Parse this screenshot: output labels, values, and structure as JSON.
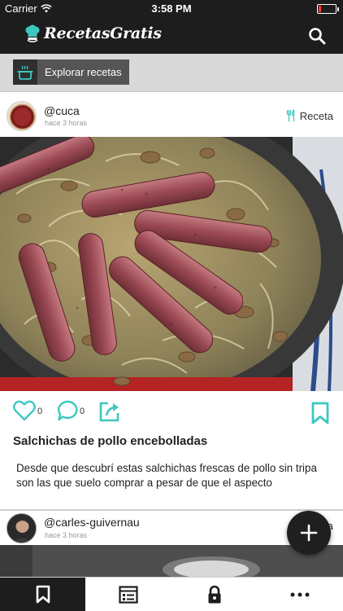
{
  "status_bar": {
    "carrier": "Carrier",
    "time": "3:58 PM",
    "battery_level": 0.15
  },
  "header": {
    "app_name": "RecetasGratis",
    "icons": [
      "chef-hat-icon",
      "search-icon"
    ]
  },
  "explore": {
    "label": "Explorar recetas",
    "icon": "pot-icon"
  },
  "posts": [
    {
      "username": "@cuca",
      "time_ago": "hace 3 horas",
      "tag_label": "Receta",
      "tag_icon": "fork-knife-icon",
      "likes": "0",
      "comments": "0",
      "title": "Salchichas de pollo encebolladas",
      "description": "Desde que descubrí estas salchichas frescas de pollo sin tripa son las que suelo comprar a pesar de que el aspecto"
    },
    {
      "username": "@carles-guivernau",
      "time_ago": "hace 3 horas",
      "tag_label": "a"
    }
  ],
  "tab_bar": {
    "items": [
      "bookmark-icon",
      "list-icon",
      "lock-icon",
      "more-icon"
    ],
    "active_index": 0
  },
  "colors": {
    "accent": "#3cc8c0",
    "dark": "#1d1d1d",
    "explore_bg": "#555555",
    "battery": "#ff3b30"
  }
}
